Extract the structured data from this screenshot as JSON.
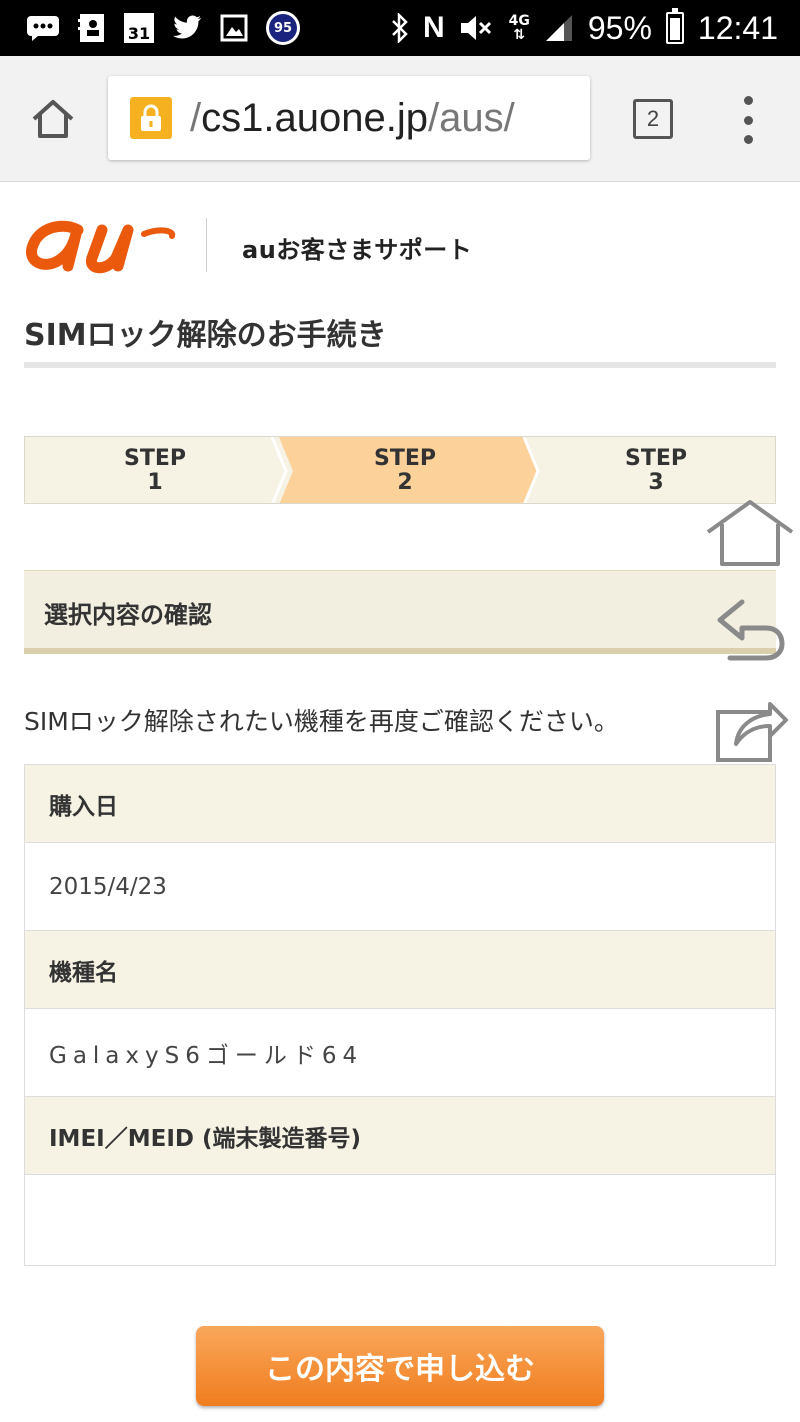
{
  "status_bar": {
    "calendar_day": "31",
    "notification_count": "95",
    "n_label": "N",
    "network_label": "4G",
    "battery": "95%",
    "time": "12:41"
  },
  "browser": {
    "url_prefix": "/",
    "url_host": "cs1.auone.jp",
    "url_path": "/aus/",
    "tab_count": "2"
  },
  "header": {
    "logo": "au",
    "support_title": "auお客さまサポート"
  },
  "page_title": "SIMロック解除のお手続き",
  "steps": [
    {
      "word": "STEP",
      "num": "1",
      "active": false
    },
    {
      "word": "STEP",
      "num": "2",
      "active": true
    },
    {
      "word": "STEP",
      "num": "3",
      "active": false
    }
  ],
  "section_title": "選択内容の確認",
  "intro_text": "SIMロック解除されたい機種を再度ご確認ください。",
  "table": {
    "purchase_label": "購入日",
    "purchase_value": "2015/4/23",
    "model_label": "機種名",
    "model_value": "GalaxyS6ゴールド64",
    "imei_label": "IMEI／MEID (端末製造番号)",
    "imei_value": ""
  },
  "submit_label": "この内容で申し込む",
  "colors": {
    "au_orange": "#eb5a0c",
    "step_active": "#fcd19a",
    "step_inactive": "#f6f3e4",
    "button_orange": "#f28a2e"
  }
}
